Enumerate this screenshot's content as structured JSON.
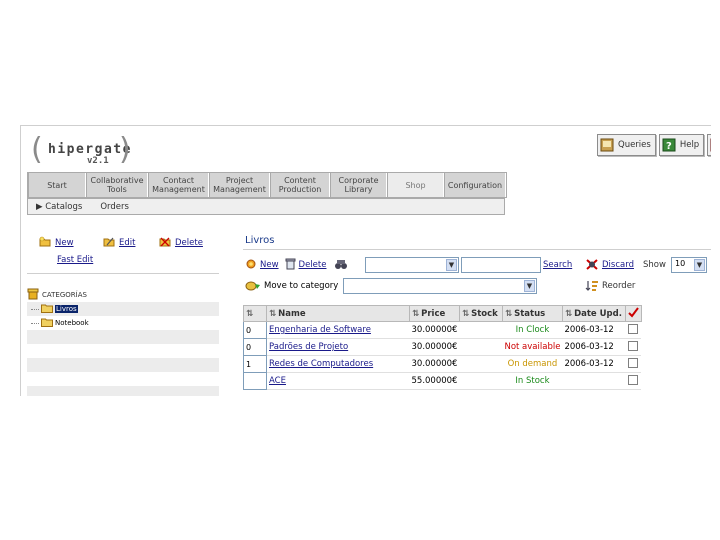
{
  "logo": {
    "name": "hipergate",
    "version": "v2.1"
  },
  "top_buttons": [
    {
      "label": "Queries",
      "icon": "queries-icon"
    },
    {
      "label": "Help",
      "icon": "help-icon"
    }
  ],
  "tabs": [
    {
      "label": "Start"
    },
    {
      "label": "Collaborative Tools"
    },
    {
      "label": "Contact Management"
    },
    {
      "label": "Project Management"
    },
    {
      "label": "Content Production"
    },
    {
      "label": "Corporate Library"
    },
    {
      "label": "Shop"
    },
    {
      "label": "Configuration"
    }
  ],
  "subnav": {
    "catalogs": "Catalogs",
    "orders": "Orders"
  },
  "sidebar": {
    "new_label": "New",
    "edit_label": "Edit",
    "delete_label": "Delete",
    "fast_edit_label": "Fast Edit",
    "categories_title": "CATEGORÍAS",
    "categories": [
      "Livros",
      "Notebook"
    ]
  },
  "content": {
    "title": "Livros",
    "toolbar": {
      "new_label": "New",
      "delete_label": "Delete",
      "search_label": "Search",
      "discard_label": "Discard",
      "show_label": "Show",
      "show_value": "10",
      "move_label": "Move to category",
      "reorder_label": "Reorder"
    },
    "columns": [
      "Name",
      "Price",
      "Stock",
      "Status",
      "Date Upd."
    ],
    "rows": [
      {
        "qty": "0",
        "name": "Engenharia de Software",
        "price": "30.00000€",
        "stock": "",
        "status": "In Clock",
        "status_kind": "instock",
        "date": "2006-03-12"
      },
      {
        "qty": "0",
        "name": "Padrões de Projeto",
        "price": "30.00000€",
        "stock": "",
        "status": "Not available",
        "status_kind": "notavail",
        "date": "2006-03-12"
      },
      {
        "qty": "1",
        "name": "Redes de Computadores",
        "price": "30.00000€",
        "stock": "",
        "status": "On demand",
        "status_kind": "ondemand",
        "date": "2006-03-12"
      },
      {
        "qty": "",
        "name": "ACE",
        "price": "55.00000€",
        "stock": "",
        "status": "In Stock",
        "status_kind": "instock",
        "date": ""
      }
    ]
  },
  "colors": {
    "link": "#1a1a8a",
    "title": "#1a3a8a",
    "instock": "#1a8a1a",
    "notavail": "#cc0000",
    "ondemand": "#c89500"
  }
}
